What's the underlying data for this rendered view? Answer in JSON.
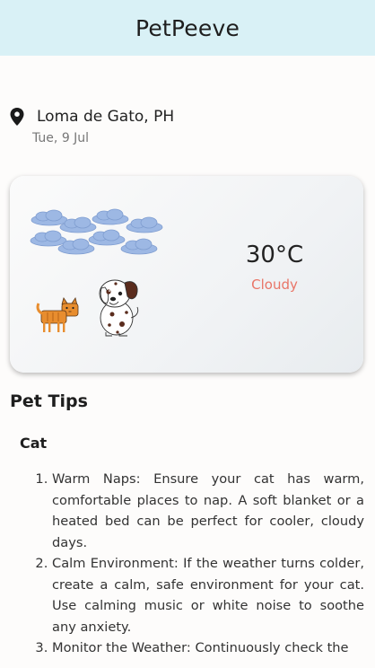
{
  "header": {
    "title": "PetPeeve"
  },
  "location": {
    "place": "Loma de Gato, PH",
    "date": "Tue, 9 Jul",
    "icon": "map-pin-icon"
  },
  "weather": {
    "temperature": "30°C",
    "condition": "Cloudy",
    "illustration": "clouds-cat-dog-illustration"
  },
  "tips": {
    "section_title": "Pet Tips",
    "pet_type": "Cat",
    "items": [
      "Warm Naps: Ensure your cat has warm, comfortable places to nap. A soft blanket or a heated bed can be perfect for cooler, cloudy days.",
      "Calm Environment: If the weather turns colder, create a calm, safe environment for your cat. Use calming music or white noise to soothe any anxiety.",
      "Monitor the Weather: Continuously check the"
    ]
  }
}
